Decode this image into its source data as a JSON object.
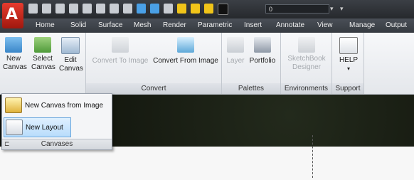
{
  "app": {
    "logo_letter": "A"
  },
  "qat": {
    "layer_value": "0"
  },
  "tabs": [
    "Home",
    "Solid",
    "Surface",
    "Mesh",
    "Render",
    "Parametric",
    "Insert",
    "Annotate",
    "View",
    "Manage",
    "Output"
  ],
  "ribbon": {
    "panels": [
      {
        "title": "",
        "tools": [
          {
            "label": "New\nCanvas"
          },
          {
            "label": "Select\nCanvas"
          },
          {
            "label": "Edit\nCanvas"
          }
        ]
      },
      {
        "title": "Convert",
        "tools": [
          {
            "label": "Convert To Image",
            "disabled": true
          },
          {
            "label": "Convert From Image"
          }
        ]
      },
      {
        "title": "Palettes",
        "tools": [
          {
            "label": "Layer",
            "disabled": true
          },
          {
            "label": "Portfolio"
          }
        ]
      },
      {
        "title": "Environments",
        "tools": [
          {
            "label": "SketchBook\nDesigner",
            "disabled": true
          }
        ]
      },
      {
        "title": "Support",
        "tools": [
          {
            "label": "HELP"
          }
        ]
      }
    ]
  },
  "dropdown": {
    "items": [
      {
        "label": "New Canvas from Image"
      },
      {
        "label": "New Layout"
      }
    ],
    "footer": "Canvases"
  },
  "colors": {
    "accent": "#cc2a1d",
    "tabbar": "#3f434a",
    "selection": "#b8dcfb"
  }
}
